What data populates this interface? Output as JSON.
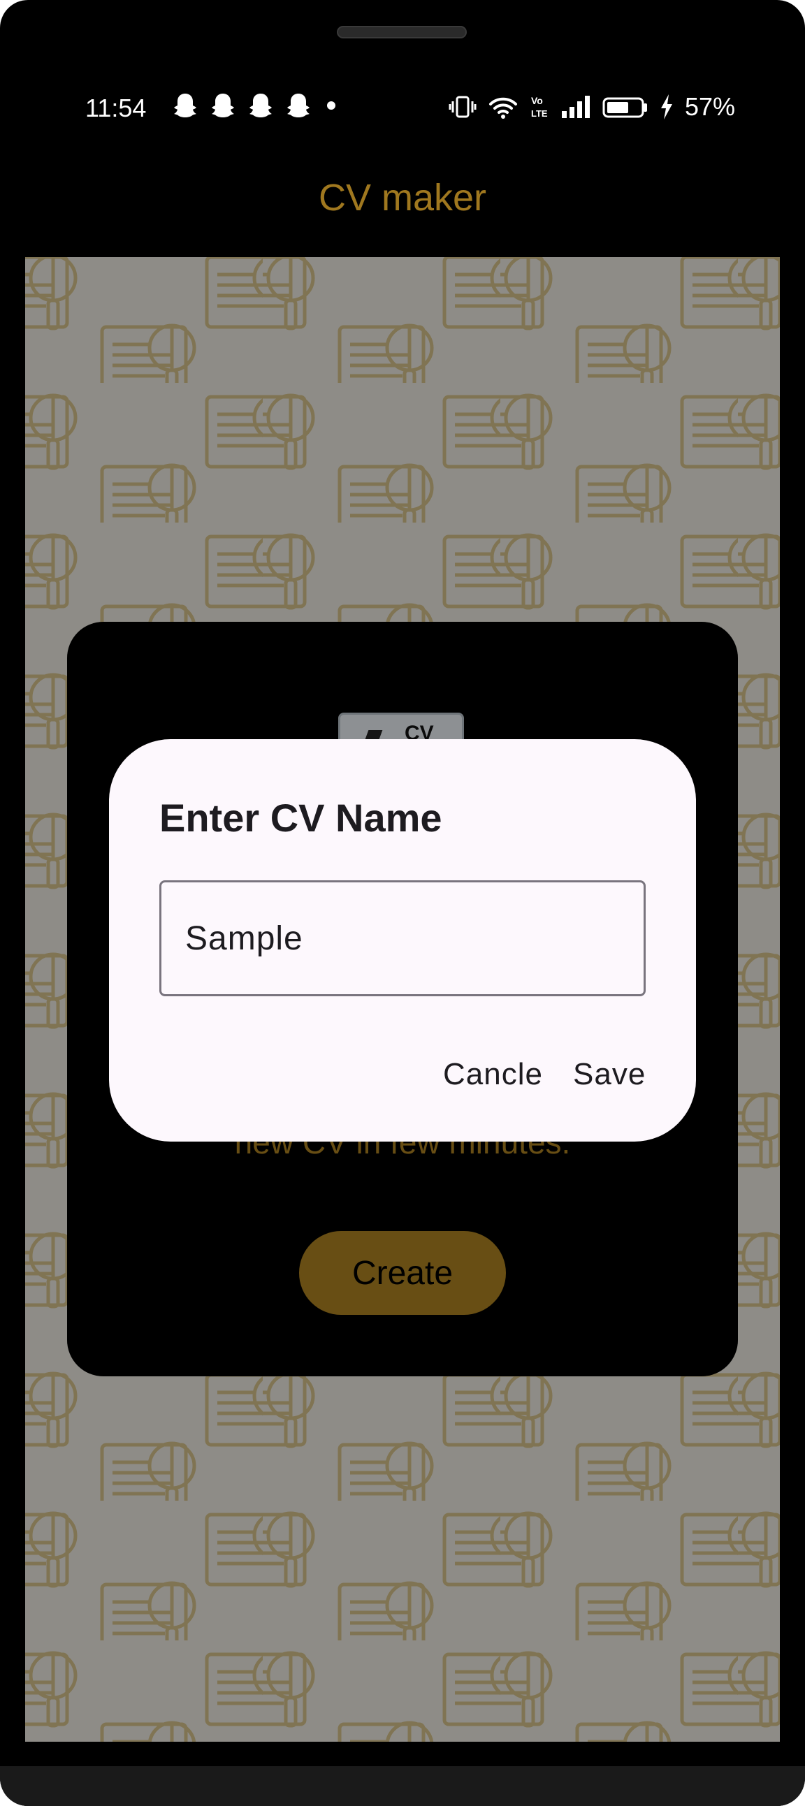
{
  "status_bar": {
    "time": "11:54",
    "battery": "57%",
    "notification_icons": [
      "snapchat-ghost-icon",
      "snapchat-ghost-icon",
      "snapchat-ghost-icon",
      "snapchat-ghost-icon",
      "more-dot-icon"
    ],
    "system_icons": [
      "vibrate-icon",
      "wifi-icon",
      "volte-icon",
      "signal-icon",
      "battery-icon",
      "charging-icon"
    ]
  },
  "app_bar": {
    "title": "CV maker"
  },
  "card": {
    "thumbnail_text": "CV",
    "description_visible": "new CV in few minutes.",
    "create_label": "Create"
  },
  "dialog": {
    "title": "Enter CV Name",
    "input_value": "Sample",
    "cancel_label": "Cancle",
    "save_label": "Save"
  },
  "colors": {
    "accent": "#A0781F",
    "dialog_bg": "#FDF8FD",
    "background": "#000000"
  }
}
